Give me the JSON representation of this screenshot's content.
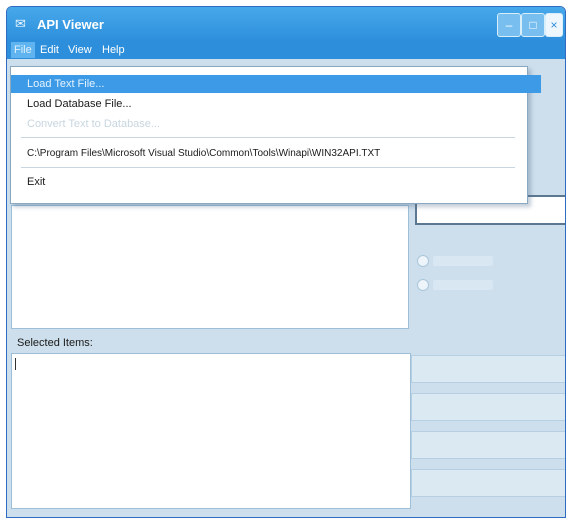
{
  "window": {
    "title": "API Viewer"
  },
  "titlebar_buttons": {
    "minimize": "–",
    "maximize": "□",
    "close": "×"
  },
  "menubar": {
    "file": "File",
    "edit": "Edit",
    "view": "View",
    "help": "Help"
  },
  "file_menu": {
    "load_text": "Load Text File...",
    "load_database": "Load Database File...",
    "disabled_item": "Convert Text to Database...",
    "recent_file": "C:\\Program Files\\Microsoft Visual Studio\\Common\\Tools\\Winapi\\WIN32API.TXT",
    "exit": "Exit"
  },
  "main": {
    "selected_items_label": "Selected Items:"
  },
  "colors": {
    "titlebar": "#2d8fdc",
    "highlight": "#3c9ae6",
    "window_bg": "#cddfec"
  }
}
